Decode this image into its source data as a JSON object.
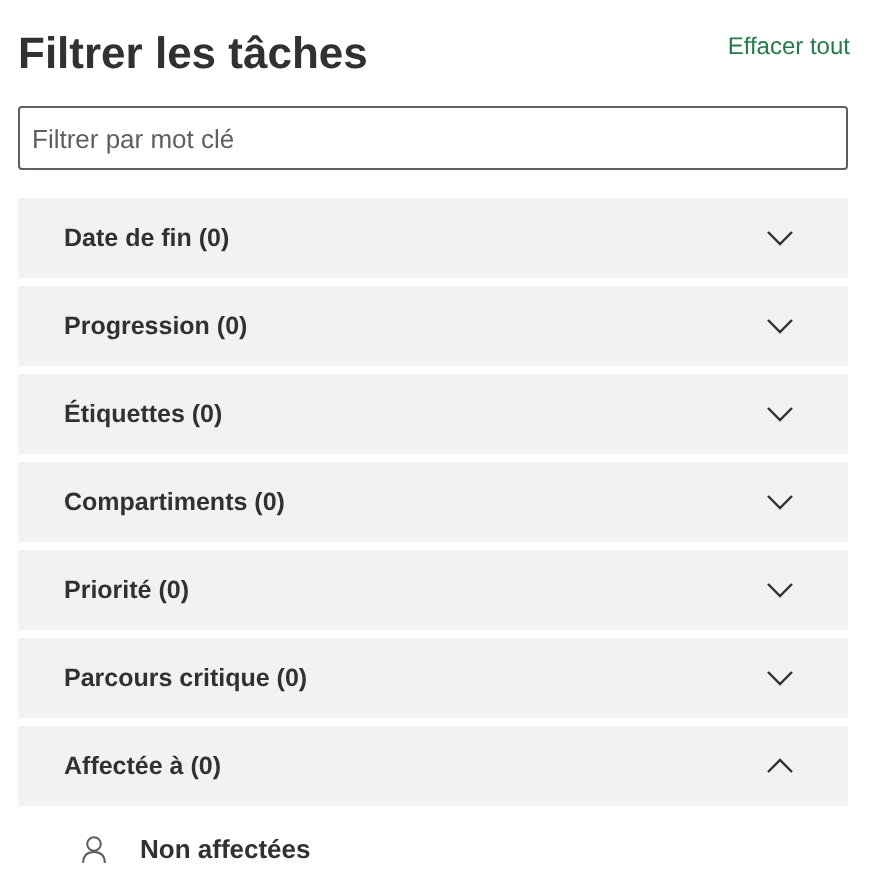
{
  "title": "Filtrer les tâches",
  "clear_all": "Effacer tout",
  "search": {
    "placeholder": "Filtrer par mot clé"
  },
  "sections": [
    {
      "label": "Date de fin (0)",
      "expanded": false
    },
    {
      "label": "Progression (0)",
      "expanded": false
    },
    {
      "label": "Étiquettes (0)",
      "expanded": false
    },
    {
      "label": "Compartiments (0)",
      "expanded": false
    },
    {
      "label": "Priorité (0)",
      "expanded": false
    },
    {
      "label": "Parcours critique (0)",
      "expanded": false
    },
    {
      "label": "Affectée à (0)",
      "expanded": true,
      "items": [
        {
          "label": "Non affectées"
        }
      ]
    }
  ]
}
